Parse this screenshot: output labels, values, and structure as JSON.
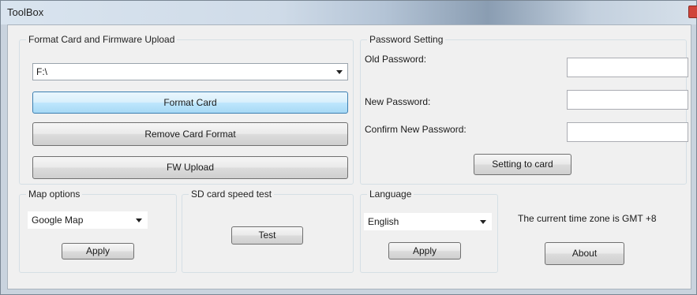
{
  "window": {
    "title": "ToolBox"
  },
  "format_group": {
    "legend": "Format Card and Firmware Upload",
    "drive_value": "F:\\",
    "format_card_label": "Format Card",
    "remove_format_label": "Remove Card Format",
    "fw_upload_label": "FW Upload"
  },
  "password_group": {
    "legend": "Password Setting",
    "old_password_label": "Old Password:",
    "new_password_label": "New Password:",
    "confirm_password_label": "Confirm New Password:",
    "old_password_value": "",
    "new_password_value": "",
    "confirm_password_value": "",
    "setting_button_label": "Setting to card"
  },
  "map_group": {
    "legend": "Map options",
    "selected": "Google Map",
    "apply_label": "Apply"
  },
  "sd_group": {
    "legend": "SD card speed test",
    "test_label": "Test"
  },
  "language_group": {
    "legend": "Language",
    "selected": "English",
    "apply_label": "Apply"
  },
  "timezone_text": "The current time zone is GMT +8",
  "about_label": "About"
}
